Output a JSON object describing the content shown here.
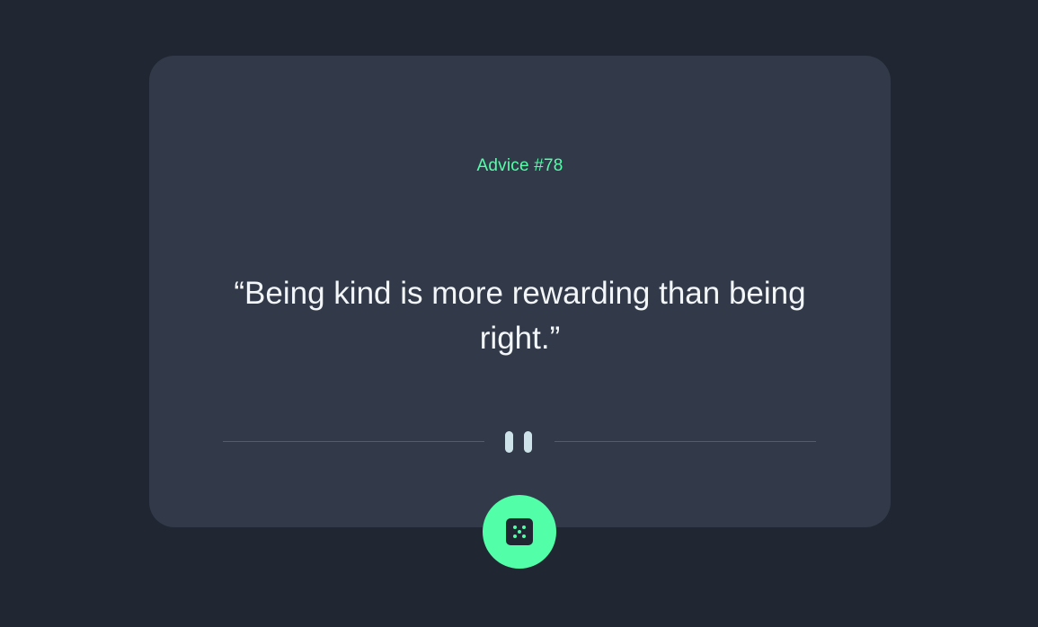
{
  "card": {
    "advice_label": "Advice #78",
    "quote": "“Being kind is more rewarding than being right.”"
  },
  "dice_button": {
    "icon": "dice-icon",
    "aria_label": "Get new advice"
  },
  "divider": {
    "icon": "pause-icon"
  },
  "colors": {
    "background": "#202632",
    "card": "#323a49",
    "accent": "#52ffa8",
    "text": "#cee3e9",
    "divider": "#4f5d74"
  }
}
